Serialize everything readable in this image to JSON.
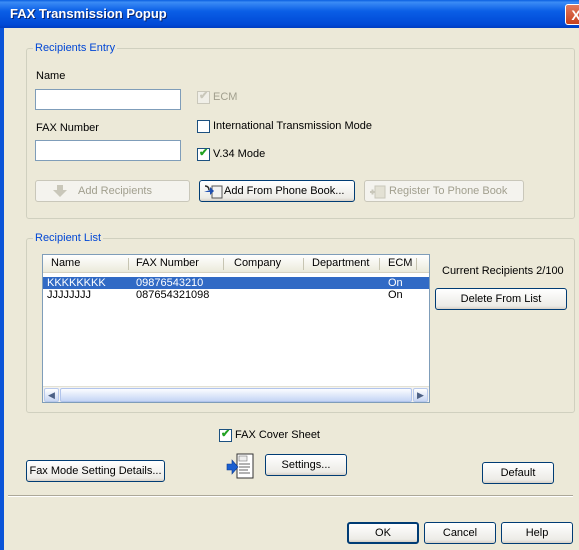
{
  "window": {
    "title": "FAX Transmission Popup",
    "close_glyph": "X"
  },
  "recipients_entry": {
    "group_label": "Recipients Entry",
    "name_label": "Name",
    "name_value": "",
    "fax_number_label": "FAX Number",
    "fax_number_value": "",
    "ecm_label": "ECM",
    "ecm_checked": true,
    "ecm_enabled": false,
    "international_label": "International Transmission Mode",
    "international_checked": false,
    "v34_label": "V.34 Mode",
    "v34_checked": true,
    "add_recipients_label": "Add Recipients",
    "add_from_phone_book_label": "Add From Phone Book...",
    "register_to_phone_book_label": "Register To Phone Book"
  },
  "recipient_list": {
    "group_label": "Recipient List",
    "columns": [
      "Name",
      "FAX Number",
      "Company",
      "Department",
      "ECM"
    ],
    "rows": [
      {
        "name": "KKKKKKKK",
        "fax": "09876543210",
        "company": "",
        "department": "",
        "ecm": "On",
        "selected": true
      },
      {
        "name": "JJJJJJJJ",
        "fax": "087654321098",
        "company": "",
        "department": "",
        "ecm": "On",
        "selected": false
      }
    ],
    "current_recipients": "Current Recipients 2/100",
    "delete_label": "Delete From List"
  },
  "cover_sheet": {
    "label": "FAX Cover Sheet",
    "checked": true,
    "settings_label": "Settings..."
  },
  "footer": {
    "fax_mode_label": "Fax Mode Setting Details...",
    "default_label": "Default",
    "ok_label": "OK",
    "cancel_label": "Cancel",
    "help_label": "Help"
  },
  "colors": {
    "title_bar": "#0a5ee6",
    "group_label": "#0046d5",
    "selection": "#316ac5",
    "check_mark": "#21a121"
  },
  "icons": [
    "close-icon",
    "add-recipients-icon",
    "phone-book-icon",
    "register-icon",
    "cover-sheet-icon",
    "scroll-left-icon",
    "scroll-right-icon"
  ]
}
